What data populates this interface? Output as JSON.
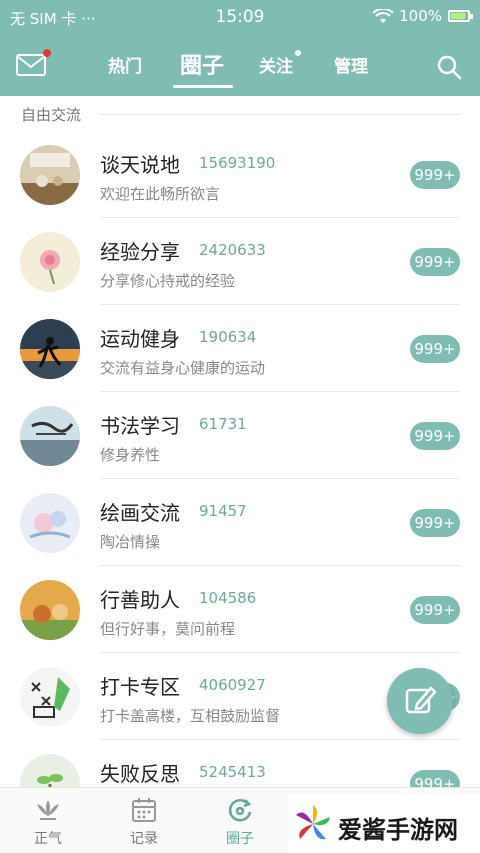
{
  "status_bar": {
    "carrier": "无 SIM 卡 ···",
    "time": "15:09",
    "battery": "100%"
  },
  "header": {
    "tabs": [
      "热门",
      "圈子",
      "关注",
      "管理"
    ],
    "active_tab": "圈子"
  },
  "section": {
    "title": "自由交流"
  },
  "circles": [
    {
      "name": "谈天说地",
      "count": "15693190",
      "desc": "欢迎在此畅所欲言",
      "badge": "999+"
    },
    {
      "name": "经验分享",
      "count": "2420633",
      "desc": "分享修心持戒的经验",
      "badge": "999+"
    },
    {
      "name": "运动健身",
      "count": "190634",
      "desc": "交流有益身心健康的运动",
      "badge": "999+"
    },
    {
      "name": "书法学习",
      "count": "61731",
      "desc": "修身养性",
      "badge": "999+"
    },
    {
      "name": "绘画交流",
      "count": "91457",
      "desc": "陶冶情操",
      "badge": "999+"
    },
    {
      "name": "行善助人",
      "count": "104586",
      "desc": "但行好事，莫问前程",
      "badge": "999+"
    },
    {
      "name": "打卡专区",
      "count": "4060927",
      "desc": "打卡盖高楼，互相鼓励监督",
      "badge": "999+"
    },
    {
      "name": "失败反思",
      "count": "5245413",
      "desc": "",
      "badge": "999+"
    }
  ],
  "bottom_nav": {
    "items": [
      "正气",
      "记录",
      "圈子"
    ],
    "active": "圈子"
  },
  "watermark": {
    "text": "爱酱手游网"
  },
  "colors": {
    "primary": "#7fbdb2",
    "badge": "#7fbdb2",
    "count": "#6aa9a0"
  }
}
